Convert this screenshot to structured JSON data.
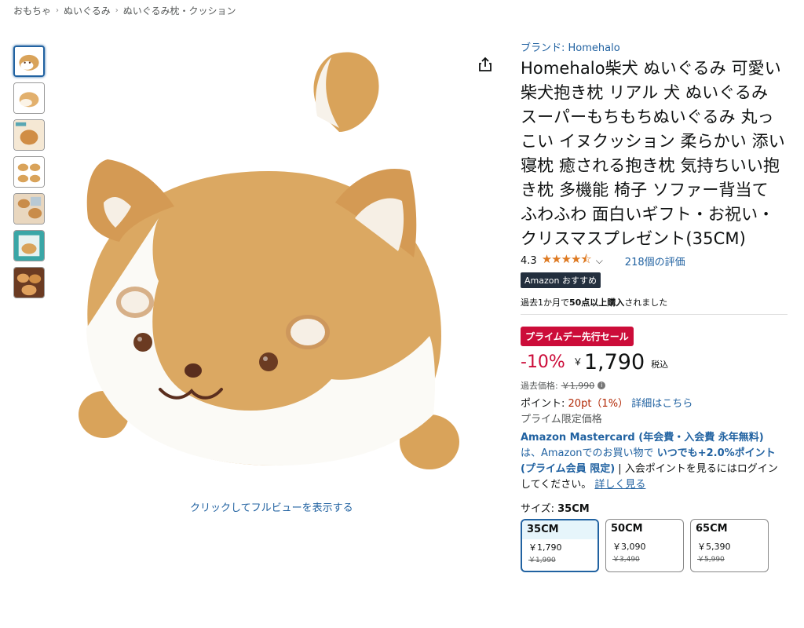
{
  "breadcrumb": [
    "おもちゃ",
    "ぬいぐるみ",
    "ぬいぐるみ枕・クッション"
  ],
  "main": {
    "fullview_text": "クリックしてフルビューを表示する"
  },
  "product": {
    "brand": "ブランド: Homehalo",
    "title": "Homehalo柴犬 ぬいぐるみ 可愛い 柴犬抱き枕 リアル 犬 ぬいぐるみ スーパーもちもちぬいぐるみ 丸っこい イヌクッション 柔らかい 添い寝枕 癒される抱き枕 気持ちいい抱き枕 多機能 椅子 ソファー背当て ふわふわ 面白いギフト・お祝い・クリスマスプレゼント(35CM)",
    "rating": "4.3",
    "rating_value": 4.3,
    "stars": "★★★★⯪",
    "chevron": "⌵",
    "reviews": "218個の評価",
    "badge": "Amazon おすすめ",
    "bought_bold": "50点以上購入",
    "bought_pre": "過去1か月で",
    "bought_post": "されました",
    "deal": "プライムデー先行セール",
    "discount": "-10%",
    "currency": "￥",
    "price": "1,790",
    "tax": "税込",
    "past_label": "過去価格:",
    "past_price": "￥1,990",
    "info_icon": "i",
    "points_label": "ポイント:",
    "points_value": "20pt（1%）",
    "points_link": "詳細はこちら",
    "prime_price": "プライム限定価格",
    "mc_title": "Amazon Mastercard (年会費・入会費 永年無料)",
    "mc_mid": "は、Amazonでのお買い物で",
    "mc_bold": "いつでも+2.0%ポイント (プライム会員 限定)",
    "mc_rest": " | 入会ポイントを見るにはログインしてください。",
    "mc_link": "詳しく見る",
    "size_label": "サイズ: ",
    "size_selected": "35CM",
    "sizes": [
      {
        "name": "35CM",
        "price": "￥1,790",
        "old": "￥1,990"
      },
      {
        "name": "50CM",
        "price": "￥3,090",
        "old": "￥3,490"
      },
      {
        "name": "65CM",
        "price": "￥5,390",
        "old": "￥5,990"
      }
    ]
  },
  "colors": {
    "link": "#2162a1",
    "deal": "#cc0c39",
    "star": "#de7921",
    "badge": "#232f3e"
  },
  "icons": [
    "share-icon",
    "info-icon",
    "chevron-down-icon",
    "star-icon"
  ]
}
